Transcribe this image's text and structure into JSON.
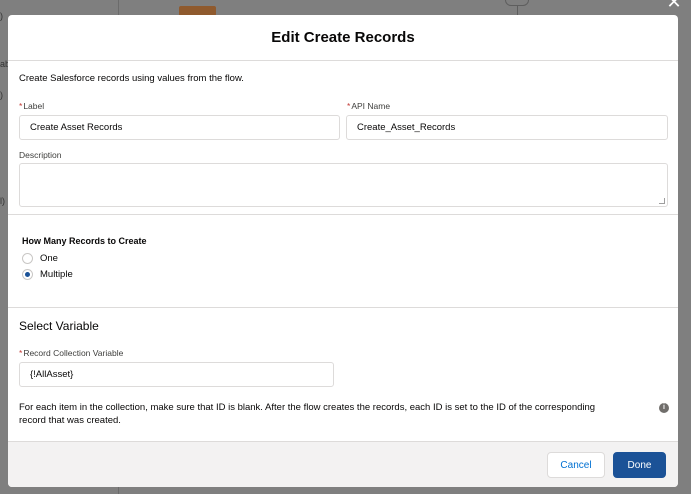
{
  "modal": {
    "title": "Edit Create Records",
    "intro": "Create Salesforce records using values from the flow.",
    "label_field": {
      "label": "Label",
      "value": "Create Asset Records"
    },
    "api_name_field": {
      "label": "API Name",
      "value": "Create_Asset_Records"
    },
    "description_field": {
      "label": "Description",
      "value": ""
    },
    "records_to_create": {
      "heading": "How Many Records to Create",
      "options": [
        {
          "label": "One",
          "selected": false
        },
        {
          "label": "Multiple",
          "selected": true
        }
      ]
    },
    "select_variable": {
      "title": "Select Variable",
      "collection_label": "Record Collection Variable",
      "collection_value": "{!AllAsset}",
      "help": "For each item in the collection, make sure that ID is blank. After the flow creates the records, each ID is set to the ID of the corresponding record that was created."
    },
    "footer": {
      "cancel_label": "Cancel",
      "done_label": "Done"
    }
  },
  "required_marker": "*",
  "background": {
    "fragments": [
      ")",
      "ab",
      ")",
      "l)"
    ]
  },
  "colors": {
    "primary": "#1b5297",
    "link": "#0070d2",
    "required": "#c23934",
    "overlay": "#7f7f7f"
  }
}
